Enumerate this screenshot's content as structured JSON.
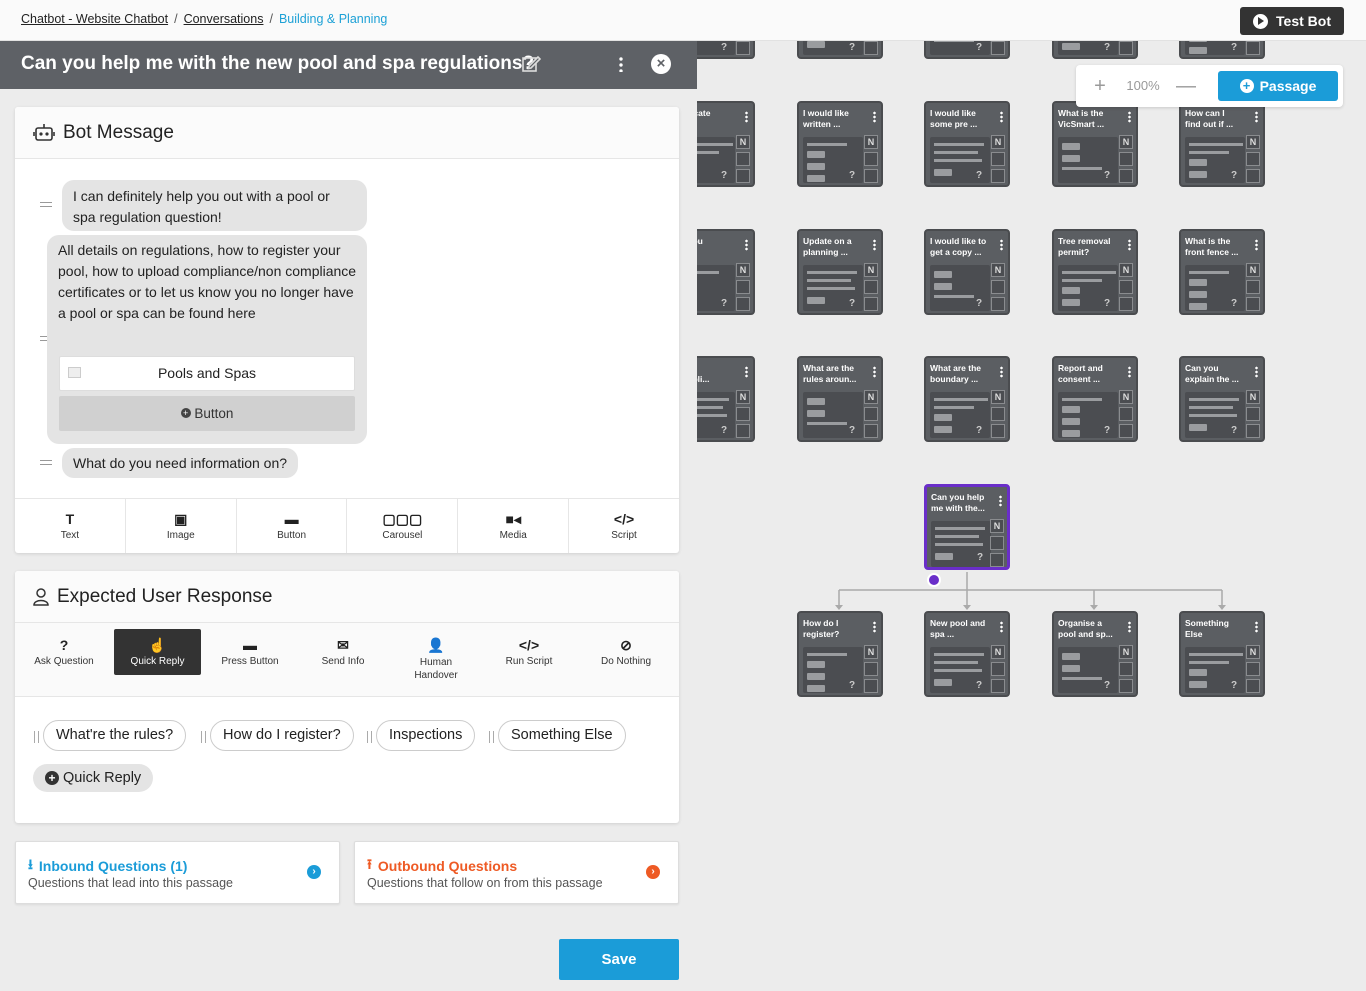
{
  "breadcrumb": {
    "items": [
      "Chatbot - Website Chatbot",
      "Conversations"
    ],
    "separator": "/",
    "current": "Building & Planning"
  },
  "topbar": {
    "test_bot_label": "Test Bot"
  },
  "canvas": {
    "zoom_level": "100%",
    "zoom_in": "+",
    "zoom_out": "—",
    "passage_label": "Passage",
    "nodes": {
      "r1": [
        "ertificate\nal ...",
        "I would like\nwritten ...",
        "I would like\nsome pre ...",
        "What is the\nVicSmart ...",
        "How can I\nfind out if ..."
      ],
      "r2": [
        "do you\ne a ...",
        "Update on a\nplanning ...",
        "I would like to\nget a copy ...",
        "Tree removal\npermit?",
        "What is the\nfront fence ..."
      ],
      "r3": [
        "do I\ne publi...",
        "What are the\nrules aroun...",
        "What are the\nboundary ...",
        "Report and\nconsent ...",
        "Can you\nexplain the ..."
      ],
      "active": "Can you help\nme with the...",
      "children": [
        "How do I\nregister?",
        "New pool and\nspa ...",
        "Organise a\npool and sp...",
        "Something\nElse"
      ],
      "n_marker": "N",
      "q_marker": "?"
    }
  },
  "panel": {
    "title": "Can you help me with the new pool and spa regulations?",
    "bot_message": {
      "heading": "Bot Message",
      "bubble1": "I can definitely help you out with a pool or spa regulation question!",
      "bubble2": "All details on regulations, how to register your pool, how to upload compliance/non compliance certificates or to let us know you no longer have a pool or spa can be found here",
      "link_button": "Pools and Spas",
      "add_button": "Button",
      "bubble3": "What do you need information on?",
      "tools": [
        "Text",
        "Image",
        "Button",
        "Carousel",
        "Media",
        "Script"
      ]
    },
    "expected_response": {
      "heading": "Expected User Response",
      "tabs": [
        "Ask Question",
        "Quick Reply",
        "Press Button",
        "Send Info",
        "Human\nHandover",
        "Run Script",
        "Do Nothing"
      ],
      "selected_tab": "Quick Reply",
      "quick_replies": [
        "What're the rules?",
        "How do I register?",
        "Inspections",
        "Something Else"
      ],
      "add_quick_reply": "Quick Reply"
    },
    "inbound": {
      "title": "Inbound Questions (1)",
      "subtitle": "Questions that lead into this passage",
      "color": "#1b9cd8"
    },
    "outbound": {
      "title": "Outbound Questions",
      "subtitle": "Questions that follow on from this passage",
      "color": "#ee5a24"
    },
    "save_label": "Save"
  }
}
